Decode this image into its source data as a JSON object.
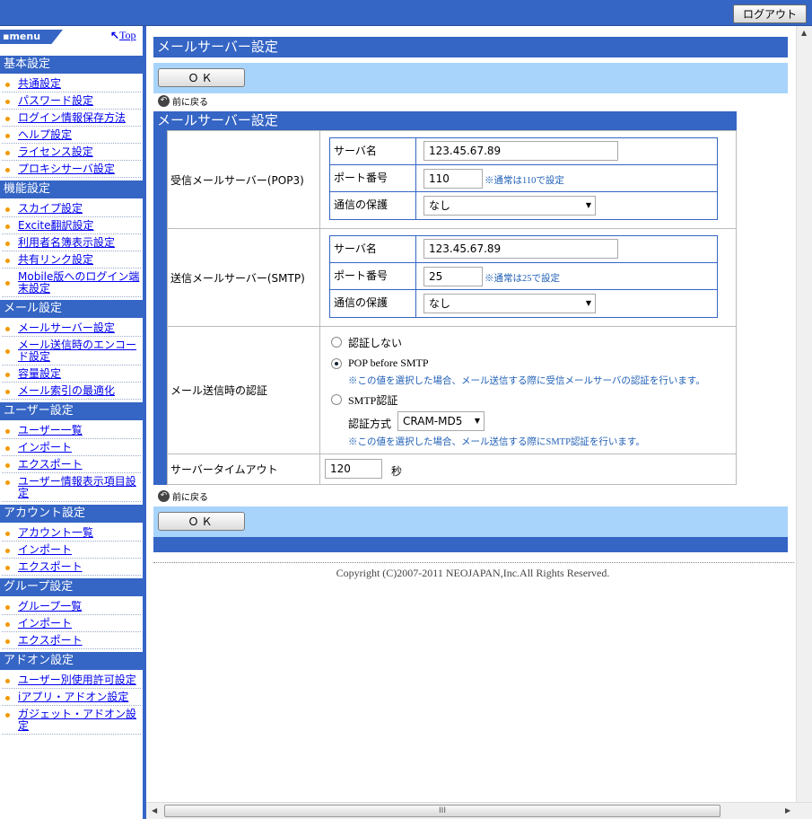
{
  "topbar": {
    "logout_label": "ログアウト"
  },
  "sidebar": {
    "logo": "menu",
    "top_link": "Top",
    "sections": [
      {
        "title": "基本設定",
        "items": [
          "共通設定",
          "パスワード設定",
          "ログイン情報保存方法",
          "ヘルプ設定",
          "ライセンス設定",
          "プロキシサーバ設定"
        ]
      },
      {
        "title": "機能設定",
        "items": [
          "スカイプ設定",
          "Excite翻訳設定",
          "利用者名簿表示設定",
          "共有リンク設定",
          "Mobile版へのログイン端末設定"
        ]
      },
      {
        "title": "メール設定",
        "items": [
          "メールサーバー設定",
          "メール送信時のエンコード設定",
          "容量設定",
          "メール索引の最適化"
        ]
      },
      {
        "title": "ユーザー設定",
        "items": [
          "ユーザー一覧",
          "インポート",
          "エクスポート",
          "ユーザー情報表示項目設定"
        ]
      },
      {
        "title": "アカウント設定",
        "items": [
          "アカウント一覧",
          "インポート",
          "エクスポート"
        ]
      },
      {
        "title": "グループ設定",
        "items": [
          "グループ一覧",
          "インポート",
          "エクスポート"
        ]
      },
      {
        "title": "アドオン設定",
        "items": [
          "ユーザー別使用許可設定",
          "iアプリ・アドオン設定",
          "ガジェット・アドオン設定"
        ]
      }
    ]
  },
  "main": {
    "page_title": "メールサーバー設定",
    "ok_label": "ＯＫ",
    "back_label": "前に戻る",
    "form_title": "メールサーバー設定",
    "pop3": {
      "label": "受信メールサーバー(POP3)",
      "server_label": "サーバ名",
      "server_value": "123.45.67.89",
      "port_label": "ポート番号",
      "port_value": "110",
      "port_note": "※通常は110で設定",
      "protect_label": "通信の保護",
      "protect_value": "なし"
    },
    "smtp": {
      "label": "送信メールサーバー(SMTP)",
      "server_label": "サーバ名",
      "server_value": "123.45.67.89",
      "port_label": "ポート番号",
      "port_value": "25",
      "port_note": "※通常は25で設定",
      "protect_label": "通信の保護",
      "protect_value": "なし"
    },
    "auth": {
      "label": "メール送信時の認証",
      "opt_none": "認証しない",
      "opt_pop": "POP before SMTP",
      "pop_note": "※この値を選択した場合、メール送信する際に受信メールサーバの認証を行います。",
      "opt_smtp": "SMTP認証",
      "method_label": "認証方式",
      "method_value": "CRAM-MD5",
      "smtp_note": "※この値を選択した場合、メール送信する際にSMTP認証を行います。"
    },
    "timeout": {
      "label": "サーバータイムアウト",
      "value": "120",
      "unit": "秒"
    },
    "copyright": "Copyright (C)2007-2011 NEOJAPAN,Inc.All Rights Reserved."
  },
  "scrollbar": {
    "thumb_label": "III"
  }
}
